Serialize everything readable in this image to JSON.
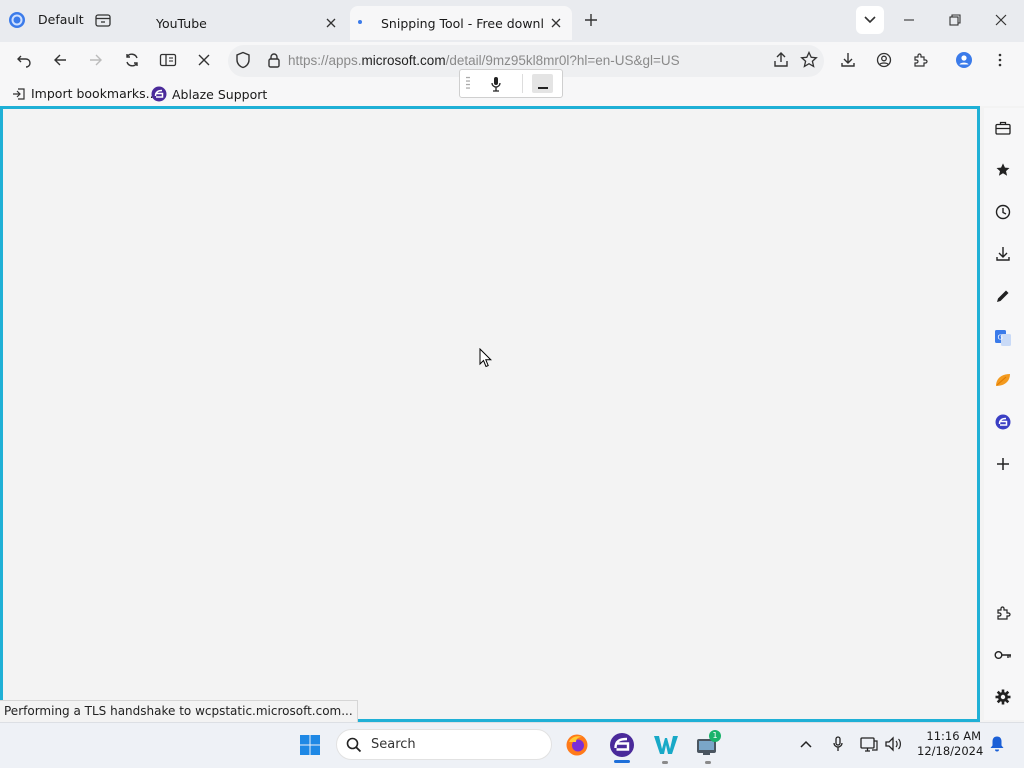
{
  "browser": {
    "profile_label": "Default",
    "tabs": [
      {
        "label": "YouTube",
        "active": false
      },
      {
        "label": "Snipping Tool - Free download",
        "active": true
      }
    ],
    "address": {
      "scheme": "https://apps.",
      "domain": "microsoft.com",
      "path": "/detail/9mz95kl8mr0l?hl=en-US&gl=US"
    },
    "bookmarks": [
      {
        "label": "Import bookmarks...",
        "icon": "import-icon"
      },
      {
        "label": "Ablaze Support",
        "icon": "ablaze-logo-icon"
      }
    ],
    "status_text": "Performing a TLS handshake to wcpstatic.microsoft.com...",
    "accent_color": "#1fb0d6"
  },
  "sidebar_icons": [
    "toolbox-icon",
    "star-icon",
    "clock-icon",
    "download-icon",
    "pen-icon",
    "translate-icon",
    "leaf-icon",
    "ablaze-icon",
    "plus-icon",
    "puzzle-icon",
    "key-icon",
    "gear-icon"
  ],
  "taskbar": {
    "search_placeholder": "Search",
    "badge_count": "1",
    "time": "11:16 AM",
    "date": "12/18/2024"
  }
}
